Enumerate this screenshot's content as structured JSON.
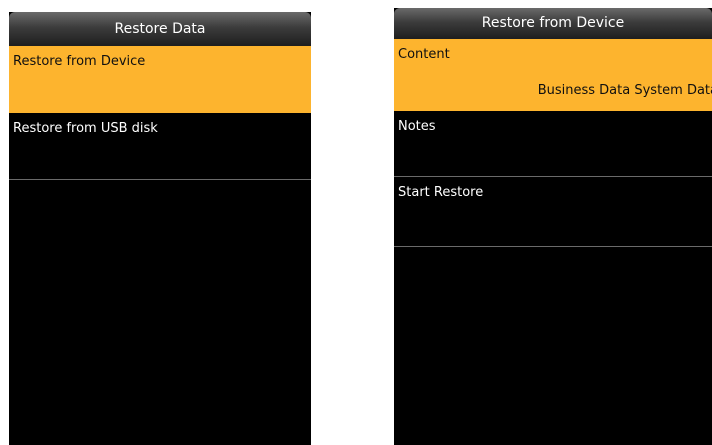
{
  "left_screen": {
    "title": "Restore Data",
    "items": [
      {
        "label": "Restore from Device",
        "selected": true
      },
      {
        "label": "Restore from USB disk",
        "selected": false
      }
    ]
  },
  "right_screen": {
    "title": "Restore from Device",
    "items": [
      {
        "label": "Content",
        "value": "Business Data System Data",
        "selected": true
      },
      {
        "label": "Notes",
        "selected": false
      },
      {
        "label": "Start Restore",
        "selected": false
      }
    ]
  },
  "colors": {
    "selected_background": "#fdb42e",
    "screen_background": "#000000",
    "divider": "#6a6a6a"
  }
}
